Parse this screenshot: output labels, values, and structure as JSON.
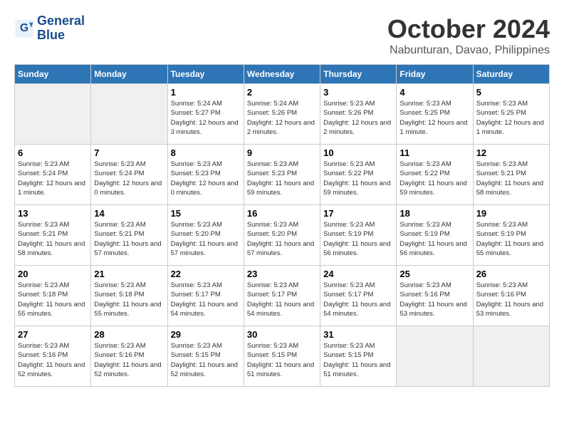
{
  "header": {
    "logo_line1": "General",
    "logo_line2": "Blue",
    "month": "October 2024",
    "location": "Nabunturan, Davao, Philippines"
  },
  "days_of_week": [
    "Sunday",
    "Monday",
    "Tuesday",
    "Wednesday",
    "Thursday",
    "Friday",
    "Saturday"
  ],
  "weeks": [
    [
      {
        "day": "",
        "empty": true
      },
      {
        "day": "",
        "empty": true
      },
      {
        "day": "1",
        "sunrise": "5:24 AM",
        "sunset": "5:27 PM",
        "daylight": "12 hours and 3 minutes."
      },
      {
        "day": "2",
        "sunrise": "5:24 AM",
        "sunset": "5:26 PM",
        "daylight": "12 hours and 2 minutes."
      },
      {
        "day": "3",
        "sunrise": "5:23 AM",
        "sunset": "5:26 PM",
        "daylight": "12 hours and 2 minutes."
      },
      {
        "day": "4",
        "sunrise": "5:23 AM",
        "sunset": "5:25 PM",
        "daylight": "12 hours and 1 minute."
      },
      {
        "day": "5",
        "sunrise": "5:23 AM",
        "sunset": "5:25 PM",
        "daylight": "12 hours and 1 minute."
      }
    ],
    [
      {
        "day": "6",
        "sunrise": "5:23 AM",
        "sunset": "5:24 PM",
        "daylight": "12 hours and 1 minute."
      },
      {
        "day": "7",
        "sunrise": "5:23 AM",
        "sunset": "5:24 PM",
        "daylight": "12 hours and 0 minutes."
      },
      {
        "day": "8",
        "sunrise": "5:23 AM",
        "sunset": "5:23 PM",
        "daylight": "12 hours and 0 minutes."
      },
      {
        "day": "9",
        "sunrise": "5:23 AM",
        "sunset": "5:23 PM",
        "daylight": "11 hours and 59 minutes."
      },
      {
        "day": "10",
        "sunrise": "5:23 AM",
        "sunset": "5:22 PM",
        "daylight": "11 hours and 59 minutes."
      },
      {
        "day": "11",
        "sunrise": "5:23 AM",
        "sunset": "5:22 PM",
        "daylight": "11 hours and 59 minutes."
      },
      {
        "day": "12",
        "sunrise": "5:23 AM",
        "sunset": "5:21 PM",
        "daylight": "11 hours and 58 minutes."
      }
    ],
    [
      {
        "day": "13",
        "sunrise": "5:23 AM",
        "sunset": "5:21 PM",
        "daylight": "11 hours and 58 minutes."
      },
      {
        "day": "14",
        "sunrise": "5:23 AM",
        "sunset": "5:21 PM",
        "daylight": "11 hours and 57 minutes."
      },
      {
        "day": "15",
        "sunrise": "5:23 AM",
        "sunset": "5:20 PM",
        "daylight": "11 hours and 57 minutes."
      },
      {
        "day": "16",
        "sunrise": "5:23 AM",
        "sunset": "5:20 PM",
        "daylight": "11 hours and 57 minutes."
      },
      {
        "day": "17",
        "sunrise": "5:23 AM",
        "sunset": "5:19 PM",
        "daylight": "11 hours and 56 minutes."
      },
      {
        "day": "18",
        "sunrise": "5:23 AM",
        "sunset": "5:19 PM",
        "daylight": "11 hours and 56 minutes."
      },
      {
        "day": "19",
        "sunrise": "5:23 AM",
        "sunset": "5:19 PM",
        "daylight": "11 hours and 55 minutes."
      }
    ],
    [
      {
        "day": "20",
        "sunrise": "5:23 AM",
        "sunset": "5:18 PM",
        "daylight": "11 hours and 55 minutes."
      },
      {
        "day": "21",
        "sunrise": "5:23 AM",
        "sunset": "5:18 PM",
        "daylight": "11 hours and 55 minutes."
      },
      {
        "day": "22",
        "sunrise": "5:23 AM",
        "sunset": "5:17 PM",
        "daylight": "11 hours and 54 minutes."
      },
      {
        "day": "23",
        "sunrise": "5:23 AM",
        "sunset": "5:17 PM",
        "daylight": "11 hours and 54 minutes."
      },
      {
        "day": "24",
        "sunrise": "5:23 AM",
        "sunset": "5:17 PM",
        "daylight": "11 hours and 54 minutes."
      },
      {
        "day": "25",
        "sunrise": "5:23 AM",
        "sunset": "5:16 PM",
        "daylight": "11 hours and 53 minutes."
      },
      {
        "day": "26",
        "sunrise": "5:23 AM",
        "sunset": "5:16 PM",
        "daylight": "11 hours and 53 minutes."
      }
    ],
    [
      {
        "day": "27",
        "sunrise": "5:23 AM",
        "sunset": "5:16 PM",
        "daylight": "11 hours and 52 minutes."
      },
      {
        "day": "28",
        "sunrise": "5:23 AM",
        "sunset": "5:16 PM",
        "daylight": "11 hours and 52 minutes."
      },
      {
        "day": "29",
        "sunrise": "5:23 AM",
        "sunset": "5:15 PM",
        "daylight": "11 hours and 52 minutes."
      },
      {
        "day": "30",
        "sunrise": "5:23 AM",
        "sunset": "5:15 PM",
        "daylight": "11 hours and 51 minutes."
      },
      {
        "day": "31",
        "sunrise": "5:23 AM",
        "sunset": "5:15 PM",
        "daylight": "11 hours and 51 minutes."
      },
      {
        "day": "",
        "empty": true
      },
      {
        "day": "",
        "empty": true
      }
    ]
  ]
}
